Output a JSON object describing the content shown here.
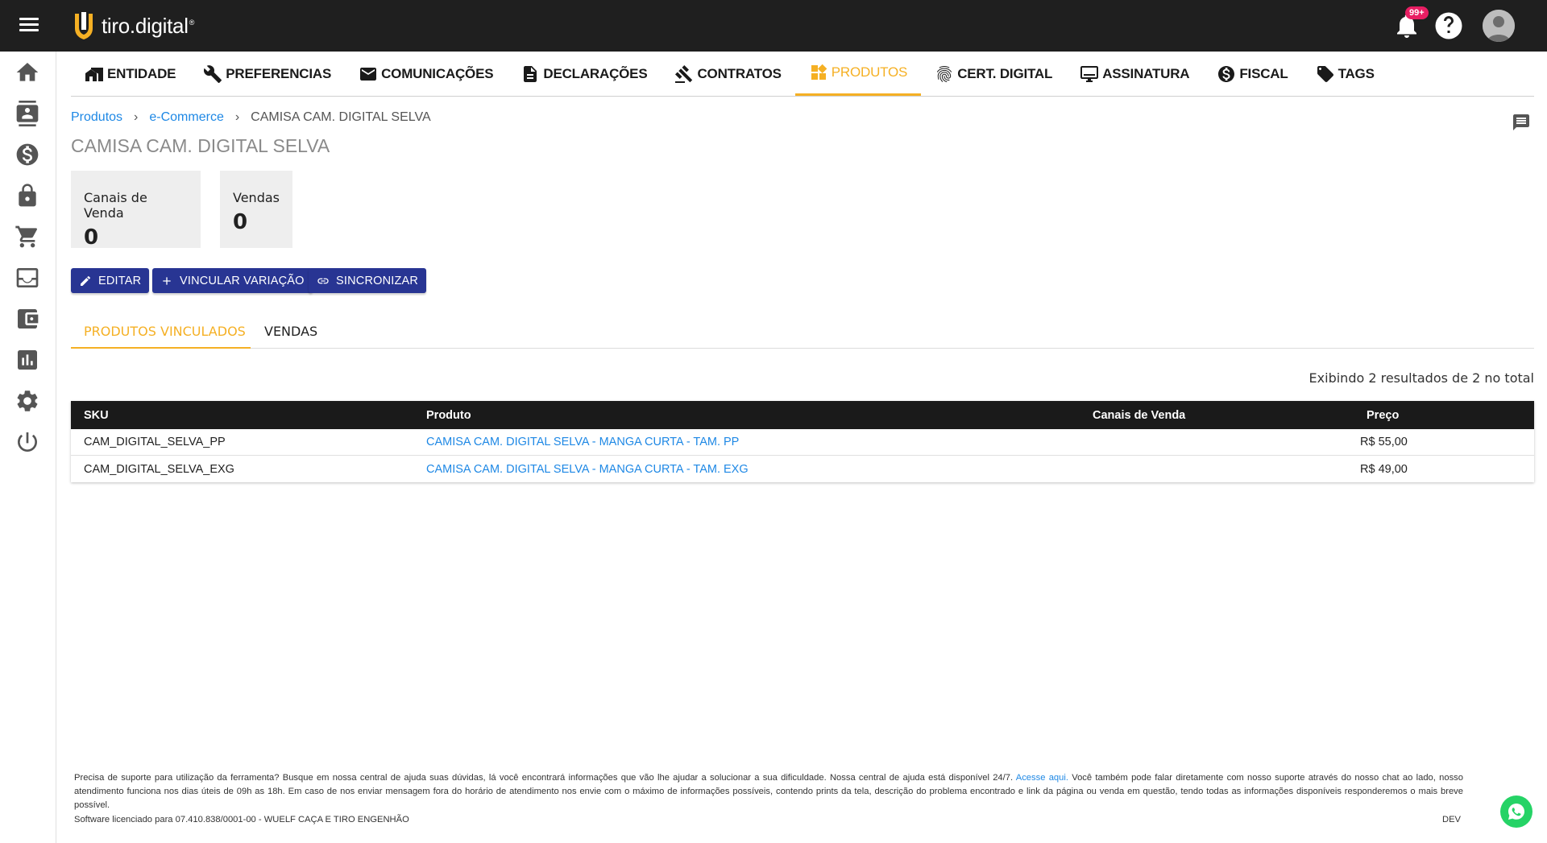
{
  "app": {
    "brand": "tiro.digital",
    "brand_mark": "®",
    "notifications_badge": "99+"
  },
  "mainnav": [
    {
      "label": "ENTIDADE",
      "icon": "home-building-icon"
    },
    {
      "label": "PREFERENCIAS",
      "icon": "wrench-icon"
    },
    {
      "label": "COMUNICAÇÕES",
      "icon": "mail-icon"
    },
    {
      "label": "DECLARAÇÕES",
      "icon": "document-icon"
    },
    {
      "label": "CONTRATOS",
      "icon": "gavel-icon"
    },
    {
      "label": "PRODUTOS",
      "icon": "widgets-icon",
      "active": true
    },
    {
      "label": "CERT. DIGITAL",
      "icon": "fingerprint-icon"
    },
    {
      "label": "ASSINATURA",
      "icon": "signature-icon"
    },
    {
      "label": "FISCAL",
      "icon": "dollar-icon"
    },
    {
      "label": "TAGS",
      "icon": "tag-icon"
    }
  ],
  "breadcrumb": {
    "items": [
      "Produtos",
      "e-Commerce"
    ],
    "current": "CAMISA CAM. DIGITAL SELVA"
  },
  "page_title": "CAMISA CAM. DIGITAL SELVA",
  "stats": [
    {
      "label": "Canais de Venda",
      "value": "0"
    },
    {
      "label": "Vendas",
      "value": "0"
    }
  ],
  "actions": {
    "edit": "EDITAR",
    "link_variation": "VINCULAR VARIAÇÃO",
    "sync": "SINCRONIZAR"
  },
  "tabs": [
    {
      "label": "PRODUTOS VINCULADOS",
      "active": true
    },
    {
      "label": "VENDAS",
      "active": false
    }
  ],
  "results_text": "Exibindo 2 resultados de 2 no total",
  "table": {
    "headers": {
      "sku": "SKU",
      "produto": "Produto",
      "canais": "Canais de Venda",
      "preco": "Preço"
    },
    "rows": [
      {
        "sku": "CAM_DIGITAL_SELVA_PP",
        "produto": "CAMISA CAM. DIGITAL SELVA - MANGA CURTA - TAM. PP",
        "canais": "",
        "preco": "R$ 55,00"
      },
      {
        "sku": "CAM_DIGITAL_SELVA_EXG",
        "produto": "CAMISA CAM. DIGITAL SELVA - MANGA CURTA - TAM. EXG",
        "canais": "",
        "preco": "R$ 49,00"
      }
    ]
  },
  "footer": {
    "help_text_1": "Precisa de suporte para utilização da ferramenta? Busque em nossa central de ajuda suas dúvidas, lá você encontrará informações que vão lhe ajudar a solucionar a sua dificuldade. Nossa central de ajuda está disponível 24/7.",
    "help_link": "Acesse aqui.",
    "help_text_2": "Você também pode falar diretamente com nosso suporte através do nosso chat ao lado, nosso atendimento funciona nos dias úteis de 09h as 18h. Em caso de nos enviar mensagem fora do horário de atendimento nos envie com o máximo de informações possíveis, contendo prints da tela, descrição do problema encontrado e link da página ou venda em questão, tendo todas as informações disponíveis responderemos o mais breve possível.",
    "license": "Software licenciado para 07.410.838/0001-00 - WUELF CAÇA E TIRO ENGENHÃO",
    "env": "DEV"
  },
  "colors": {
    "topbar": "#1f1f1f",
    "accent": "#f5b024",
    "button": "#283593",
    "link": "#1e88e5",
    "badge": "#e91e63"
  }
}
